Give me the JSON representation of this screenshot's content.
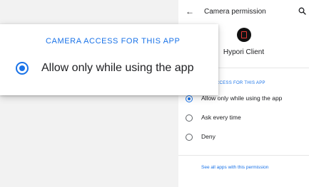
{
  "app_bar": {
    "back_icon": "arrow-back-icon",
    "title": "Camera permission",
    "search_icon": "search-icon"
  },
  "app": {
    "icon": "hypori-app-icon",
    "name": "Hypori Client"
  },
  "section": {
    "header": "CAMERA ACCESS FOR THIS APP",
    "header_visible": "ERA ACCESS FOR THIS APP"
  },
  "options": [
    {
      "label": "Allow only while using the app",
      "selected": true
    },
    {
      "label": "Ask every time",
      "selected": false
    },
    {
      "label": "Deny",
      "selected": false
    }
  ],
  "footer": {
    "link_label": "See all apps with this permission"
  },
  "zoom_callout": {
    "header": "CAMERA ACCESS FOR THIS APP",
    "option_label": "Allow only while using the app",
    "selected": true
  },
  "colors": {
    "accent": "#1a73e8",
    "text": "#202124",
    "background": "#f2f2f2"
  }
}
